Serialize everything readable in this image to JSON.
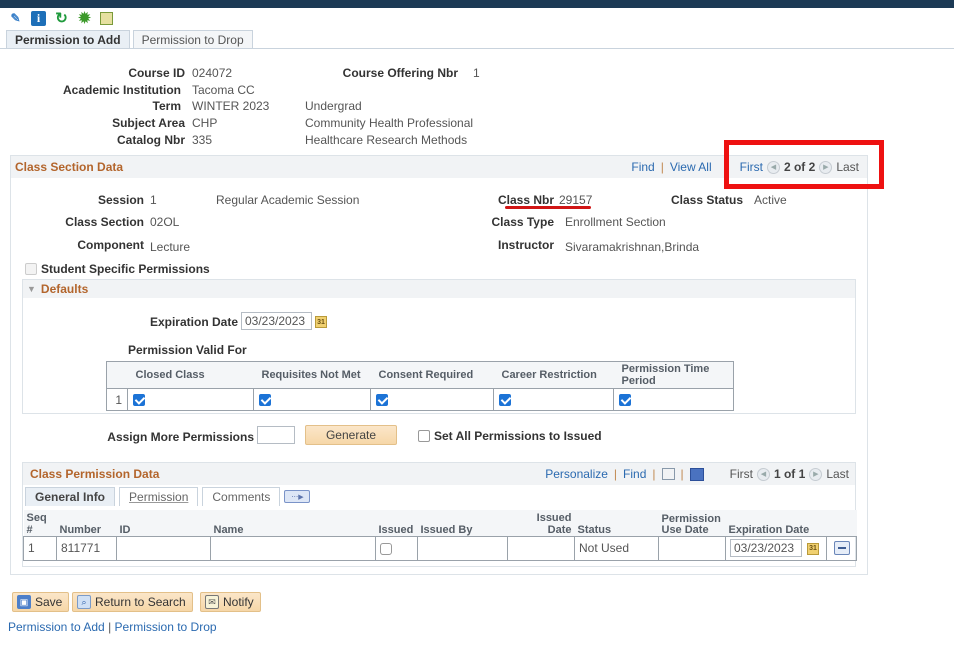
{
  "toolbar": {
    "icons": [
      "help-icon",
      "info-icon",
      "refresh-icon",
      "gear-icon",
      "report-icon"
    ]
  },
  "page_tabs": [
    {
      "label": "Permission to Add",
      "active": true
    },
    {
      "label": "Permission to Drop",
      "active": false
    }
  ],
  "course": {
    "course_id_label": "Course ID",
    "course_id": "024072",
    "offering_label": "Course Offering Nbr",
    "offering": "1",
    "institution_label": "Academic Institution",
    "institution": "Tacoma CC",
    "term_label": "Term",
    "term": "WINTER 2023",
    "career": "Undergrad",
    "subject_label": "Subject Area",
    "subject": "CHP",
    "subject_desc": "Community Health Professional",
    "catalog_label": "Catalog Nbr",
    "catalog": "335",
    "catalog_desc": "Healthcare Research Methods"
  },
  "class_section": {
    "title": "Class Section Data",
    "find": "Find",
    "view_all": "View All",
    "first": "First",
    "pager": "2 of 2",
    "last": "Last",
    "session_label": "Session",
    "session": "1",
    "session_desc": "Regular Academic Session",
    "section_label": "Class Section",
    "section": "02OL",
    "component_label": "Component",
    "component": "Lecture",
    "class_nbr_label": "Class Nbr",
    "class_nbr": "29157",
    "class_status_label": "Class Status",
    "class_status": "Active",
    "class_type_label": "Class Type",
    "class_type": "Enrollment Section",
    "instructor_label": "Instructor",
    "instructor": "Sivaramakrishnan,Brinda",
    "student_specific_label": "Student Specific Permissions",
    "student_specific_checked": false
  },
  "defaults": {
    "title": "Defaults",
    "expiration_label": "Expiration Date",
    "expiration": "03/23/2023",
    "valid_for_label": "Permission Valid For",
    "columns": [
      "Closed Class",
      "Requisites Not Met",
      "Consent Required",
      "Career Restriction",
      "Permission Time Period"
    ],
    "row_num": "1",
    "checked": [
      true,
      true,
      true,
      true,
      true
    ]
  },
  "assign": {
    "label": "Assign More Permissions",
    "value": "",
    "generate": "Generate",
    "set_all_label": "Set All Permissions to Issued",
    "set_all_checked": false
  },
  "class_permission": {
    "title": "Class Permission Data",
    "personalize": "Personalize",
    "find": "Find",
    "first": "First",
    "pager": "1 of 1",
    "last": "Last",
    "tabs": [
      "General Info",
      "Permission",
      "Comments"
    ],
    "columns": [
      "Seq #",
      "Number",
      "ID",
      "Name",
      "Issued",
      "Issued By",
      "Issued Date",
      "Status",
      "Permission Use Date",
      "Expiration Date"
    ],
    "rows": [
      {
        "seq": "1",
        "number": "811771",
        "id": "",
        "name": "",
        "issued": false,
        "issued_by": "",
        "issued_date": "",
        "status": "Not Used",
        "use_date": "",
        "expiration": "03/23/2023"
      }
    ]
  },
  "buttons": {
    "save": "Save",
    "return": "Return to Search",
    "notify": "Notify"
  },
  "footer_links": {
    "add": "Permission to Add",
    "sep": "|",
    "drop": "Permission to Drop"
  }
}
